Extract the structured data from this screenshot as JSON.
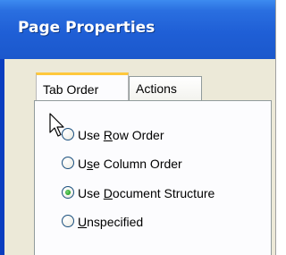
{
  "window": {
    "title": "Page Properties"
  },
  "tabs": [
    {
      "label": "Tab Order",
      "active": true
    },
    {
      "label": "Actions",
      "active": false
    }
  ],
  "tab_order": {
    "options": [
      {
        "prefix": "Use ",
        "mnemonic": "R",
        "suffix": "ow Order",
        "full": "Use Row Order",
        "selected": false
      },
      {
        "prefix": "U",
        "mnemonic": "s",
        "suffix": "e Column Order",
        "full": "Use Column Order",
        "selected": false
      },
      {
        "prefix": "Use ",
        "mnemonic": "D",
        "suffix": "ocument Structure",
        "full": "Use Document Structure",
        "selected": true
      },
      {
        "prefix": "",
        "mnemonic": "U",
        "suffix": "nspecified",
        "full": "Unspecified",
        "selected": false
      }
    ]
  },
  "colors": {
    "titlebar": "#1f5fd6",
    "tab_highlight": "#ffc83c",
    "radio_selected": "#21a121"
  },
  "icons": {
    "cursor": "mouse-pointer-arrow"
  }
}
